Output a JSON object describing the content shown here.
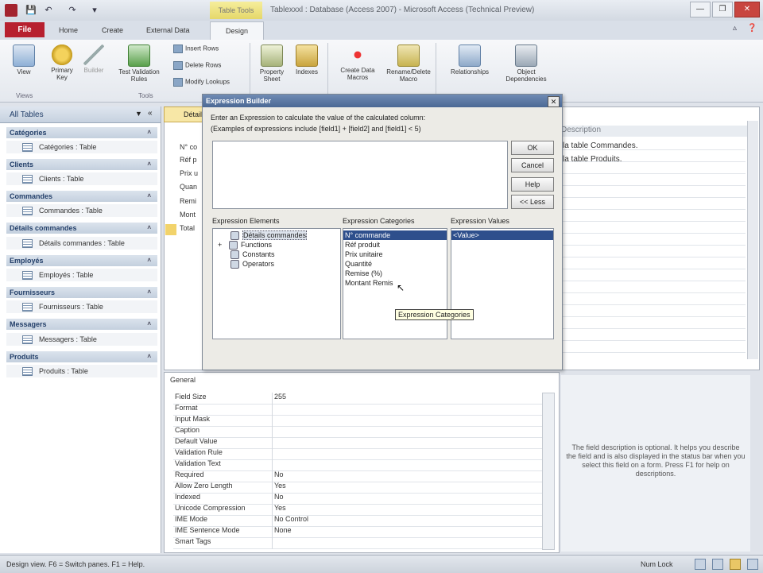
{
  "window": {
    "title": "Tablexxxl : Database (Access 2007) - Microsoft Access (Technical Preview)",
    "context_tab": "Table Tools",
    "minimize": "—",
    "restore": "❐",
    "close": "✕"
  },
  "tabs": {
    "file": "File",
    "home": "Home",
    "create": "Create",
    "external_data": "External Data",
    "design": "Design"
  },
  "ribbon": {
    "view": "View",
    "primary_key": "Primary Key",
    "builder": "Builder",
    "test_validation": "Test Validation Rules",
    "insert_rows": "Insert Rows",
    "delete_rows": "Delete Rows",
    "modify_lookups": "Modify Lookups",
    "property_sheet": "Property Sheet",
    "indexes": "Indexes",
    "create_data_macros": "Create Data Macros",
    "manage_events": "Rename/Delete Macro",
    "relationships": "Relationships",
    "object_dependencies": "Object Dependencies",
    "groups": {
      "views": "Views",
      "tools": "Tools"
    }
  },
  "nav": {
    "header": "All Tables",
    "groups": [
      {
        "name": "Catégories",
        "item": "Catégories : Table"
      },
      {
        "name": "Clients",
        "item": "Clients : Table"
      },
      {
        "name": "Commandes",
        "item": "Commandes : Table"
      },
      {
        "name": "Détails commandes",
        "item": "Détails commandes : Table"
      },
      {
        "name": "Employés",
        "item": "Employés : Table"
      },
      {
        "name": "Fournisseurs",
        "item": "Fournisseurs : Table"
      },
      {
        "name": "Messagers",
        "item": "Messagers : Table"
      },
      {
        "name": "Produits",
        "item": "Produits : Table"
      }
    ]
  },
  "design": {
    "doc_tab": "Détails commandes",
    "fields": [
      "N° co",
      "Réf p",
      "Prix u",
      "Quan",
      "Remi",
      "Mont",
      "Total"
    ],
    "description_header": "Description",
    "descriptions": [
      "la table Commandes.",
      "la table Produits."
    ]
  },
  "properties": {
    "tab": "General",
    "rows": [
      {
        "name": "Field Size",
        "value": "255"
      },
      {
        "name": "Format",
        "value": ""
      },
      {
        "name": "Input Mask",
        "value": ""
      },
      {
        "name": "Caption",
        "value": ""
      },
      {
        "name": "Default Value",
        "value": ""
      },
      {
        "name": "Validation Rule",
        "value": ""
      },
      {
        "name": "Validation Text",
        "value": ""
      },
      {
        "name": "Required",
        "value": "No"
      },
      {
        "name": "Allow Zero Length",
        "value": "Yes"
      },
      {
        "name": "Indexed",
        "value": "No"
      },
      {
        "name": "Unicode Compression",
        "value": "Yes"
      },
      {
        "name": "IME Mode",
        "value": "No Control"
      },
      {
        "name": "IME Sentence Mode",
        "value": "None"
      },
      {
        "name": "Smart Tags",
        "value": ""
      }
    ],
    "help": "The field description is optional. It helps you describe the field and is also displayed in the status bar when you select this field on a form. Press F1 for help on descriptions."
  },
  "dialog": {
    "title": "Expression Builder",
    "instruction": "Enter an Expression to calculate the value of the calculated column:",
    "examples": "(Examples of expressions include [field1] + [field2] and [field1] < 5)",
    "expression_value": "",
    "buttons": {
      "ok": "OK",
      "cancel": "Cancel",
      "help": "Help",
      "less": "<< Less"
    },
    "elements_label": "Expression Elements",
    "categories_label": "Expression Categories",
    "values_label": "Expression Values",
    "elements": [
      "Détails commandes",
      "Functions",
      "Constants",
      "Operators"
    ],
    "categories": [
      "N° commande",
      "Réf produit",
      "Prix unitaire",
      "Quantité",
      "Remise (%)",
      "Montant Remis"
    ],
    "values": [
      "<Value>"
    ],
    "tooltip": "Expression Categories"
  },
  "status": {
    "left": "Design view.  F6 = Switch panes.  F1 = Help.",
    "right": "Num Lock"
  },
  "colors": {
    "file_tab": "#b7202f",
    "dialog_title": "#4b6894",
    "selection": "#2e4f8c"
  }
}
